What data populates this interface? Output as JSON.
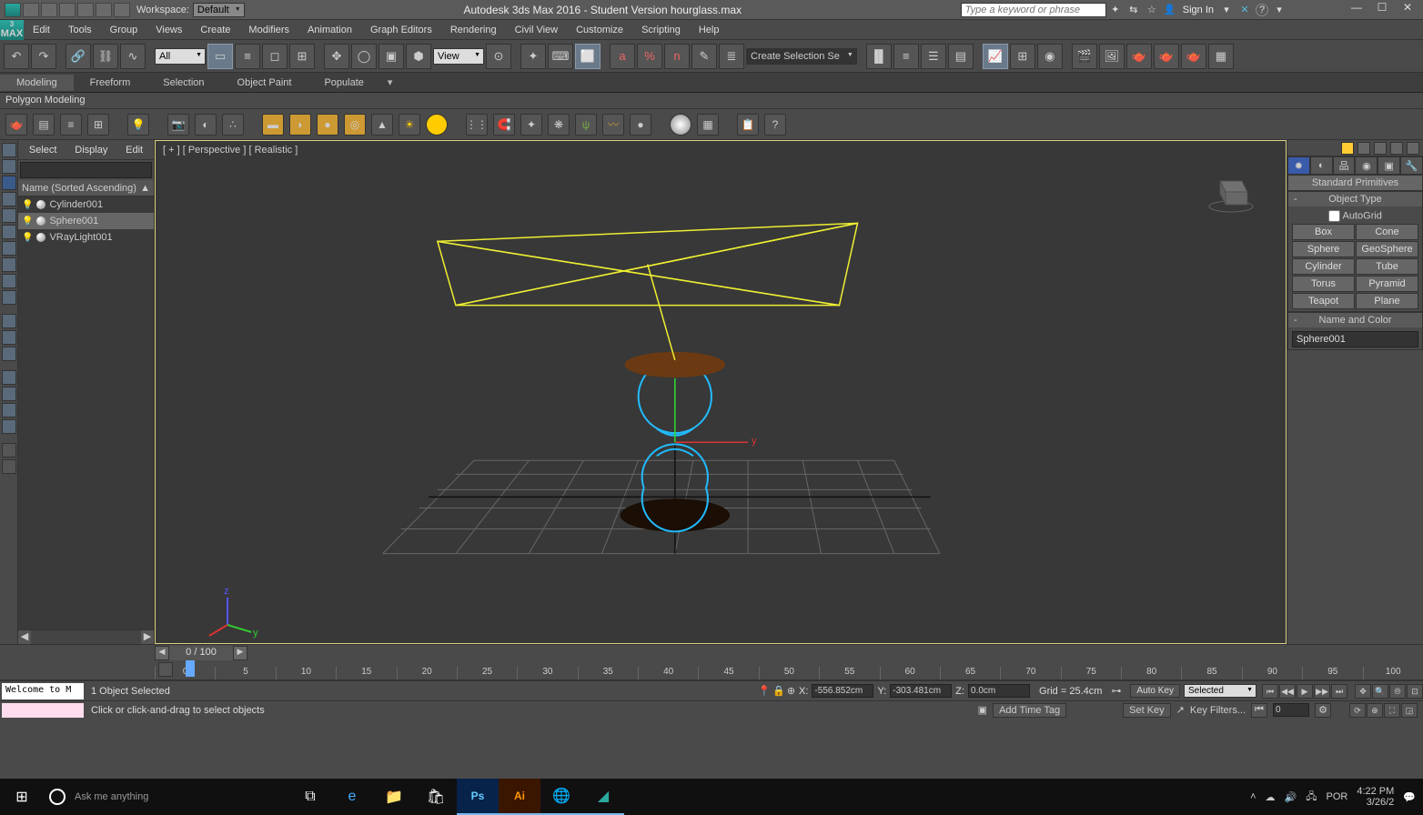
{
  "quickbar": {
    "workspace_label": "Workspace:",
    "workspace_value": "Default",
    "title": "Autodesk 3ds Max 2016 - Student Version    hourglass.max",
    "search_placeholder": "Type a keyword or phrase",
    "signin": "Sign In"
  },
  "max_badge_top": "3",
  "max_badge_bottom": "MAX",
  "menu": [
    "Edit",
    "Tools",
    "Group",
    "Views",
    "Create",
    "Modifiers",
    "Animation",
    "Graph Editors",
    "Rendering",
    "Civil View",
    "Customize",
    "Scripting",
    "Help"
  ],
  "toolbar": {
    "dd_all": "All",
    "dd_view": "View",
    "dd_selset": "Create Selection Se"
  },
  "ribbon": {
    "tabs": [
      "Modeling",
      "Freeform",
      "Selection",
      "Object Paint",
      "Populate"
    ],
    "active": 0,
    "poly": "Polygon Modeling"
  },
  "scene": {
    "menu": [
      "Select",
      "Display",
      "Edit"
    ],
    "header": "Name (Sorted Ascending)",
    "items": [
      {
        "name": "Cylinder001",
        "sel": false
      },
      {
        "name": "Sphere001",
        "sel": true
      },
      {
        "name": "VRayLight001",
        "sel": false
      }
    ]
  },
  "viewport": {
    "label": "[ + ] [ Perspective ] [ Realistic ]"
  },
  "cmd": {
    "sub": "Standard Primitives",
    "objtype_title": "Object Type",
    "autogrid": "AutoGrid",
    "primitives": [
      "Box",
      "Cone",
      "Sphere",
      "GeoSphere",
      "Cylinder",
      "Tube",
      "Torus",
      "Pyramid",
      "Teapot",
      "Plane"
    ],
    "namecolor_title": "Name and Color",
    "obj_name": "Sphere001"
  },
  "timeline": {
    "slider_label": "0 / 100",
    "ticks": [
      "0",
      "5",
      "10",
      "15",
      "20",
      "25",
      "30",
      "35",
      "40",
      "45",
      "50",
      "55",
      "60",
      "65",
      "70",
      "75",
      "80",
      "85",
      "90",
      "95",
      "100"
    ]
  },
  "workspace_tag": "Workspace: Default",
  "status": {
    "welcome": "Welcome to M",
    "sel": "1 Object Selected",
    "x_label": "X:",
    "x": "-556.852cm",
    "y_label": "Y:",
    "y": "-303.481cm",
    "z_label": "Z:",
    "z": "0.0cm",
    "grid": "Grid = 25.4cm",
    "autokey": "Auto Key",
    "setkey": "Set Key",
    "selected_dd": "Selected",
    "keyfilters": "Key Filters...",
    "frame": "0"
  },
  "hint": {
    "text": "Click or click-and-drag to select objects",
    "addtag": "Add Time Tag"
  },
  "taskbar": {
    "ask": "Ask me anything",
    "time": "4:22 PM",
    "date": "3/26/2",
    "lang": "POR"
  }
}
